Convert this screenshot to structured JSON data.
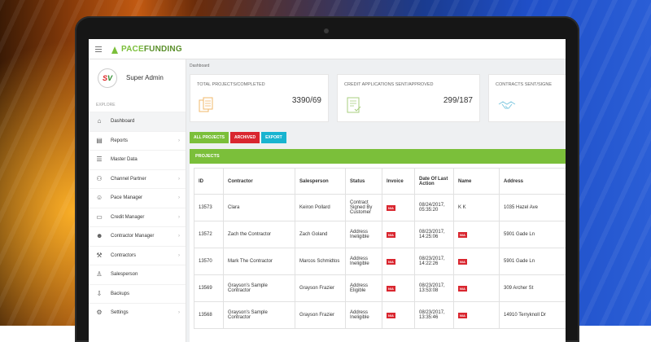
{
  "app": {
    "logo_pace": "PACE",
    "logo_funding": "FUNDING"
  },
  "user": {
    "initial_s": "S",
    "initial_v": "V",
    "name": "Super Admin"
  },
  "sidebar": {
    "section_label": "EXPLORE",
    "items": [
      {
        "label": "Dashboard",
        "icon": "home-icon",
        "active": true
      },
      {
        "label": "Reports",
        "icon": "reports-icon"
      },
      {
        "label": "Master Data",
        "icon": "database-icon"
      },
      {
        "label": "Channel Partner",
        "icon": "network-icon"
      },
      {
        "label": "Pace Manager",
        "icon": "manager-icon"
      },
      {
        "label": "Credit Manager",
        "icon": "credit-icon"
      },
      {
        "label": "Contractor Manager",
        "icon": "contractor-manager-icon"
      },
      {
        "label": "Contractors",
        "icon": "contractors-icon"
      },
      {
        "label": "Salesperson",
        "icon": "salesperson-icon"
      },
      {
        "label": "Backups",
        "icon": "backup-icon"
      },
      {
        "label": "Settings",
        "icon": "gear-icon"
      }
    ]
  },
  "breadcrumb": "Dashboard",
  "cards": [
    {
      "title": "TOTAL PROJECTS/COMPLETED",
      "value": "3390/69",
      "icon": "documents-icon"
    },
    {
      "title": "CREDIT APPLICATIONS SENT/APPROVED",
      "value": "299/187",
      "icon": "checklist-icon"
    },
    {
      "title": "CONTRACTS SENT/SIGNE",
      "value": "",
      "icon": "handshake-icon"
    }
  ],
  "tabs": {
    "all_projects": "ALL PROJECTS",
    "archived": "ARCHIVED",
    "export": "EXPORT"
  },
  "projects": {
    "title": "PROJECTS",
    "columns": {
      "id": "ID",
      "contractor": "Contractor",
      "salesperson": "Salesperson",
      "status": "Status",
      "invoice": "Invoice",
      "date": "Date Of Last Action",
      "name": "Name",
      "address": "Address"
    },
    "na_label": "N/A",
    "rows": [
      {
        "id": "13573",
        "contractor": "Clara",
        "salesperson": "Keiron Pollard",
        "status": "Contract Signed By Customer",
        "invoice": "N/A",
        "date": "08/24/2017, 05:35:20",
        "name": "K K",
        "name_na": false,
        "address": "1035 Hazel Ave"
      },
      {
        "id": "13572",
        "contractor": "Zach the Contractor",
        "salesperson": "Zach Goland",
        "status": "Address Ineligible",
        "invoice": "N/A",
        "date": "08/23/2017, 14:25:06",
        "name": "N/A",
        "name_na": true,
        "address": "5901 Gade Ln"
      },
      {
        "id": "13570",
        "contractor": "Mark The Contractor",
        "salesperson": "Marcos Schmidtos",
        "status": "Address Ineligible",
        "invoice": "N/A",
        "date": "08/23/2017, 14:22:26",
        "name": "N/A",
        "name_na": true,
        "address": "5901 Gade Ln"
      },
      {
        "id": "13569",
        "contractor": "Grayson's Sample Contractor",
        "salesperson": "Grayson Frazier",
        "status": "Address Eligible",
        "invoice": "N/A",
        "date": "08/23/2017, 13:53:08",
        "name": "N/A",
        "name_na": true,
        "address": "309 Archer St"
      },
      {
        "id": "13568",
        "contractor": "Grayson's Sample Contractor",
        "salesperson": "Grayson Frazier",
        "status": "Address Ineligible",
        "invoice": "N/A",
        "date": "08/23/2017, 13:35:46",
        "name": "N/A",
        "name_na": true,
        "address": "14910 Terryknoll Dr"
      }
    ]
  },
  "colors": {
    "brand_green": "#7bbf3a",
    "archived_red": "#d9262f",
    "export_cyan": "#18b4d0"
  }
}
